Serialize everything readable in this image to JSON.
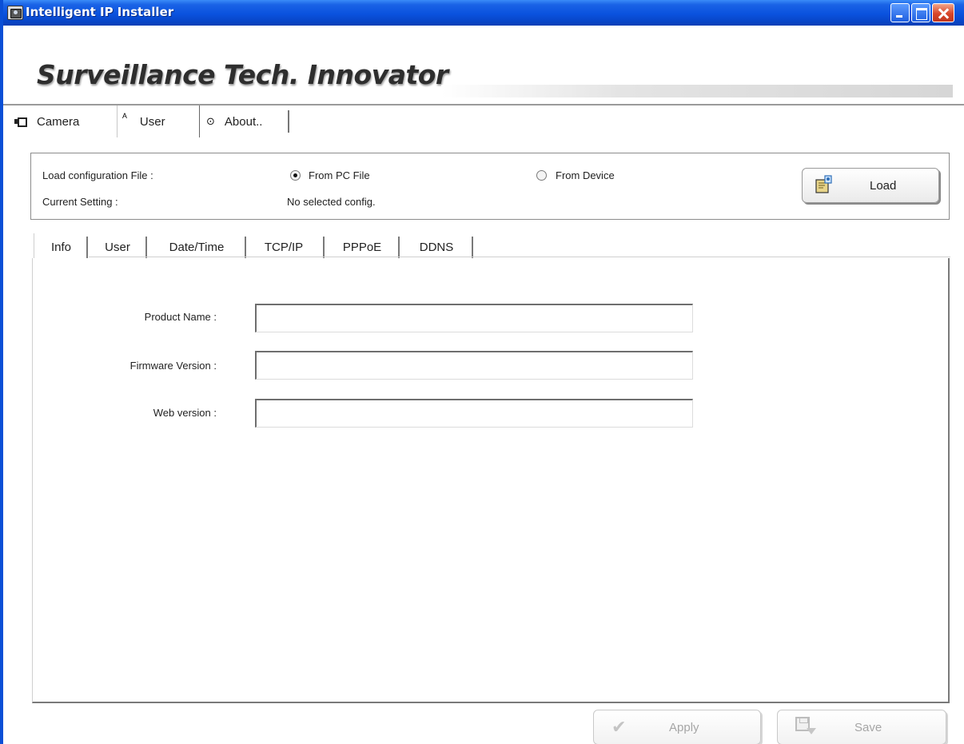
{
  "window": {
    "title": "Intelligent IP Installer"
  },
  "banner": {
    "logo_text": "Surveillance Tech. Innovator"
  },
  "main_tabs": [
    {
      "label": "Camera",
      "icon": "camera-icon"
    },
    {
      "label": "User",
      "icon": "user-icon",
      "active": true
    },
    {
      "label": "About..",
      "icon": "info-icon"
    }
  ],
  "config": {
    "load_label": "Load configuration File :",
    "current_label": "Current Setting :",
    "option_pc": "From PC File",
    "option_device": "From Device",
    "selected_option": "From PC File",
    "current_value": "No selected config.",
    "load_button": "Load"
  },
  "sub_tabs": [
    {
      "label": "Info",
      "active": true
    },
    {
      "label": "User"
    },
    {
      "label": "Date/Time"
    },
    {
      "label": "TCP/IP"
    },
    {
      "label": "PPPoE"
    },
    {
      "label": "DDNS"
    }
  ],
  "info": {
    "product_name_label": "Product Name :",
    "product_name_value": "",
    "firmware_label": "Firmware Version :",
    "firmware_value": "",
    "web_label": "Web version :",
    "web_value": ""
  },
  "actions": {
    "apply": "Apply",
    "save": "Save"
  },
  "colors": {
    "titlebar": "#0a52de",
    "close": "#d8462a",
    "disabled_text": "#a6a6a6"
  }
}
